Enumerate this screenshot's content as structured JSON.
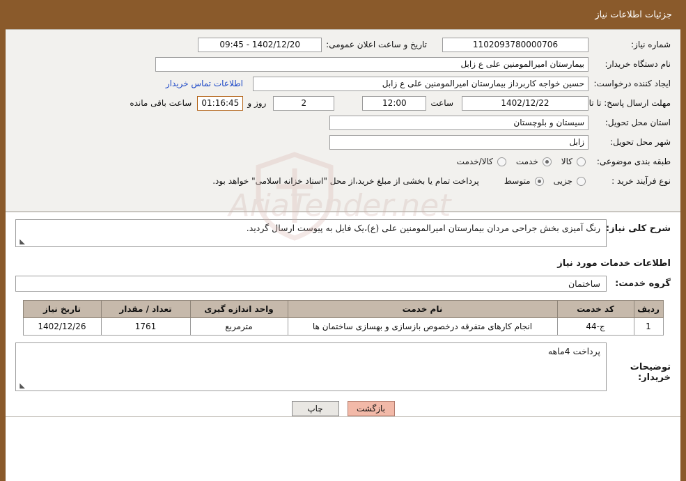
{
  "header": {
    "title": "جزئیات اطلاعات نیاز"
  },
  "form": {
    "need_number_label": "شماره نیاز:",
    "need_number_value": "1102093780000706",
    "announce_datetime_label": "تاریخ و ساعت اعلان عمومی:",
    "announce_datetime_value": "09:45 - 1402/12/20",
    "buyer_org_label": "نام دستگاه خریدار:",
    "buyer_org_value": "بیمارستان امیرالمومنین علی  ع  زابل",
    "creator_label": "ایجاد کننده درخواست:",
    "creator_value": "حسین خواجه کاربرداز بیمارستان امیرالمومنین علی  ع  زابل",
    "contact_link": "اطلاعات تماس خریدار",
    "deadline_label": "مهلت ارسال پاسخ: تا تاریخ:",
    "deadline_date": "1402/12/22",
    "hour_label": "ساعت",
    "hour_value": "12:00",
    "days_value": "2",
    "days_label": "روز و",
    "countdown_value": "01:16:45",
    "countdown_label": "ساعت باقی مانده",
    "province_label": "استان محل تحویل:",
    "province_value": "سیستان و بلوچستان",
    "city_label": "شهر محل تحویل:",
    "city_value": "زابل",
    "category_label": "طبقه بندی موضوعی:",
    "category_options": [
      {
        "label": "کالا",
        "selected": false
      },
      {
        "label": "خدمت",
        "selected": true
      },
      {
        "label": "کالا/خدمت",
        "selected": false
      }
    ],
    "purchase_type_label": "نوع فرآیند خرید :",
    "purchase_type_options": [
      {
        "label": "جزیی",
        "selected": false
      },
      {
        "label": "متوسط",
        "selected": true
      }
    ],
    "purchase_note": "پرداخت تمام یا بخشی از مبلغ خرید،از محل \"اسناد خزانه اسلامی\" خواهد بود."
  },
  "description": {
    "label": "شرح کلی نیاز:",
    "value": "رنگ آمیزی بخش جراحی مردان بیمارستان امیرالمومنین علی (ع)،یک فایل به پیوست ارسال گردید."
  },
  "services": {
    "section_title": "اطلاعات خدمات مورد نیاز",
    "group_label": "گروه خدمت:",
    "group_value": "ساختمان",
    "columns": [
      "ردیف",
      "کد خدمت",
      "نام خدمت",
      "واحد اندازه گیری",
      "تعداد / مقدار",
      "تاریخ نیاز"
    ],
    "rows": [
      {
        "row": "1",
        "code": "ج-44",
        "name": "انجام کارهای متفرقه درخصوص بازسازی و بهسازی ساختمان ها",
        "unit": "مترمربع",
        "qty": "1761",
        "date": "1402/12/26"
      }
    ]
  },
  "buyer_notes": {
    "label": "توضیحات خریدار:",
    "value": "پرداخت 4ماهه"
  },
  "footer": {
    "print_label": "چاپ",
    "back_label": "بازگشت"
  },
  "watermark": {
    "text": "AriaTender.net"
  }
}
